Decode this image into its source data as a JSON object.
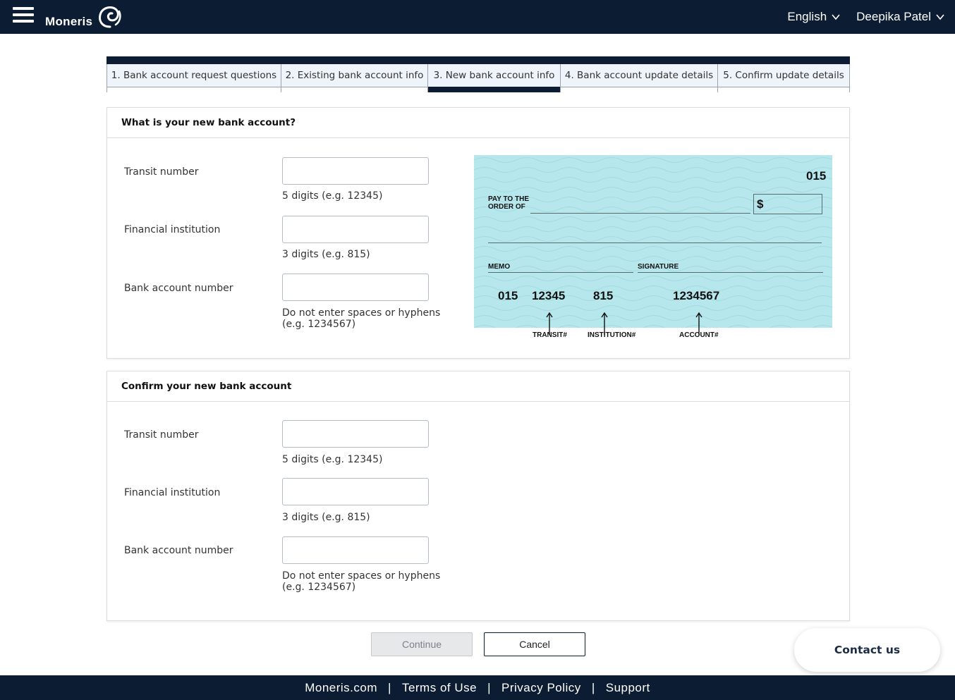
{
  "header": {
    "brand": "Moneris",
    "language": "English",
    "user": "Deepika Patel"
  },
  "stepper": {
    "steps": [
      {
        "label": "1. Bank account request questions"
      },
      {
        "label": "2. Existing bank account info"
      },
      {
        "label": "3. New bank account info"
      },
      {
        "label": "4. Bank account update details"
      },
      {
        "label": "5. Confirm update details"
      }
    ],
    "active": "3. New bank account info"
  },
  "new_account": {
    "title": "What is your new bank account?",
    "transit": {
      "label": "Transit number",
      "value": "",
      "hint": "5 digits (e.g. 12345)"
    },
    "institution": {
      "label": "Financial institution",
      "value": "",
      "hint": "3 digits (e.g. 815)"
    },
    "account": {
      "label": "Bank account number",
      "value": "",
      "hint": "Do not enter spaces or hyphens (e.g. 1234567)"
    }
  },
  "cheque": {
    "number": "015",
    "pay_line1": "PAY TO THE",
    "pay_line2": "ORDER OF",
    "dollar": "$",
    "memo": "MEMO",
    "signature": "SIGNATURE",
    "micr_cheque": "015",
    "micr_transit": "12345",
    "micr_institution": "815",
    "micr_account": "1234567",
    "label_transit": "TRANSIT#",
    "label_institution": "INSTITUTION#",
    "label_account": "ACCOUNT#"
  },
  "confirm_account": {
    "title": "Confirm your new bank account",
    "transit": {
      "label": "Transit number",
      "value": "",
      "hint": "5 digits (e.g. 12345)"
    },
    "institution": {
      "label": "Financial institution",
      "value": "",
      "hint": "3 digits (e.g. 815)"
    },
    "account": {
      "label": "Bank account number",
      "value": "",
      "hint": "Do not enter spaces or hyphens (e.g. 1234567)"
    }
  },
  "actions": {
    "continue": "Continue",
    "cancel": "Cancel"
  },
  "contact": "Contact us",
  "footer": {
    "links": [
      "Moneris.com",
      "Terms of Use",
      "Privacy Policy",
      "Support"
    ]
  },
  "colors": {
    "navy": "#0c1d33",
    "cheque_bg": "#b6e7ec",
    "step_bg": "#eef4f9"
  }
}
